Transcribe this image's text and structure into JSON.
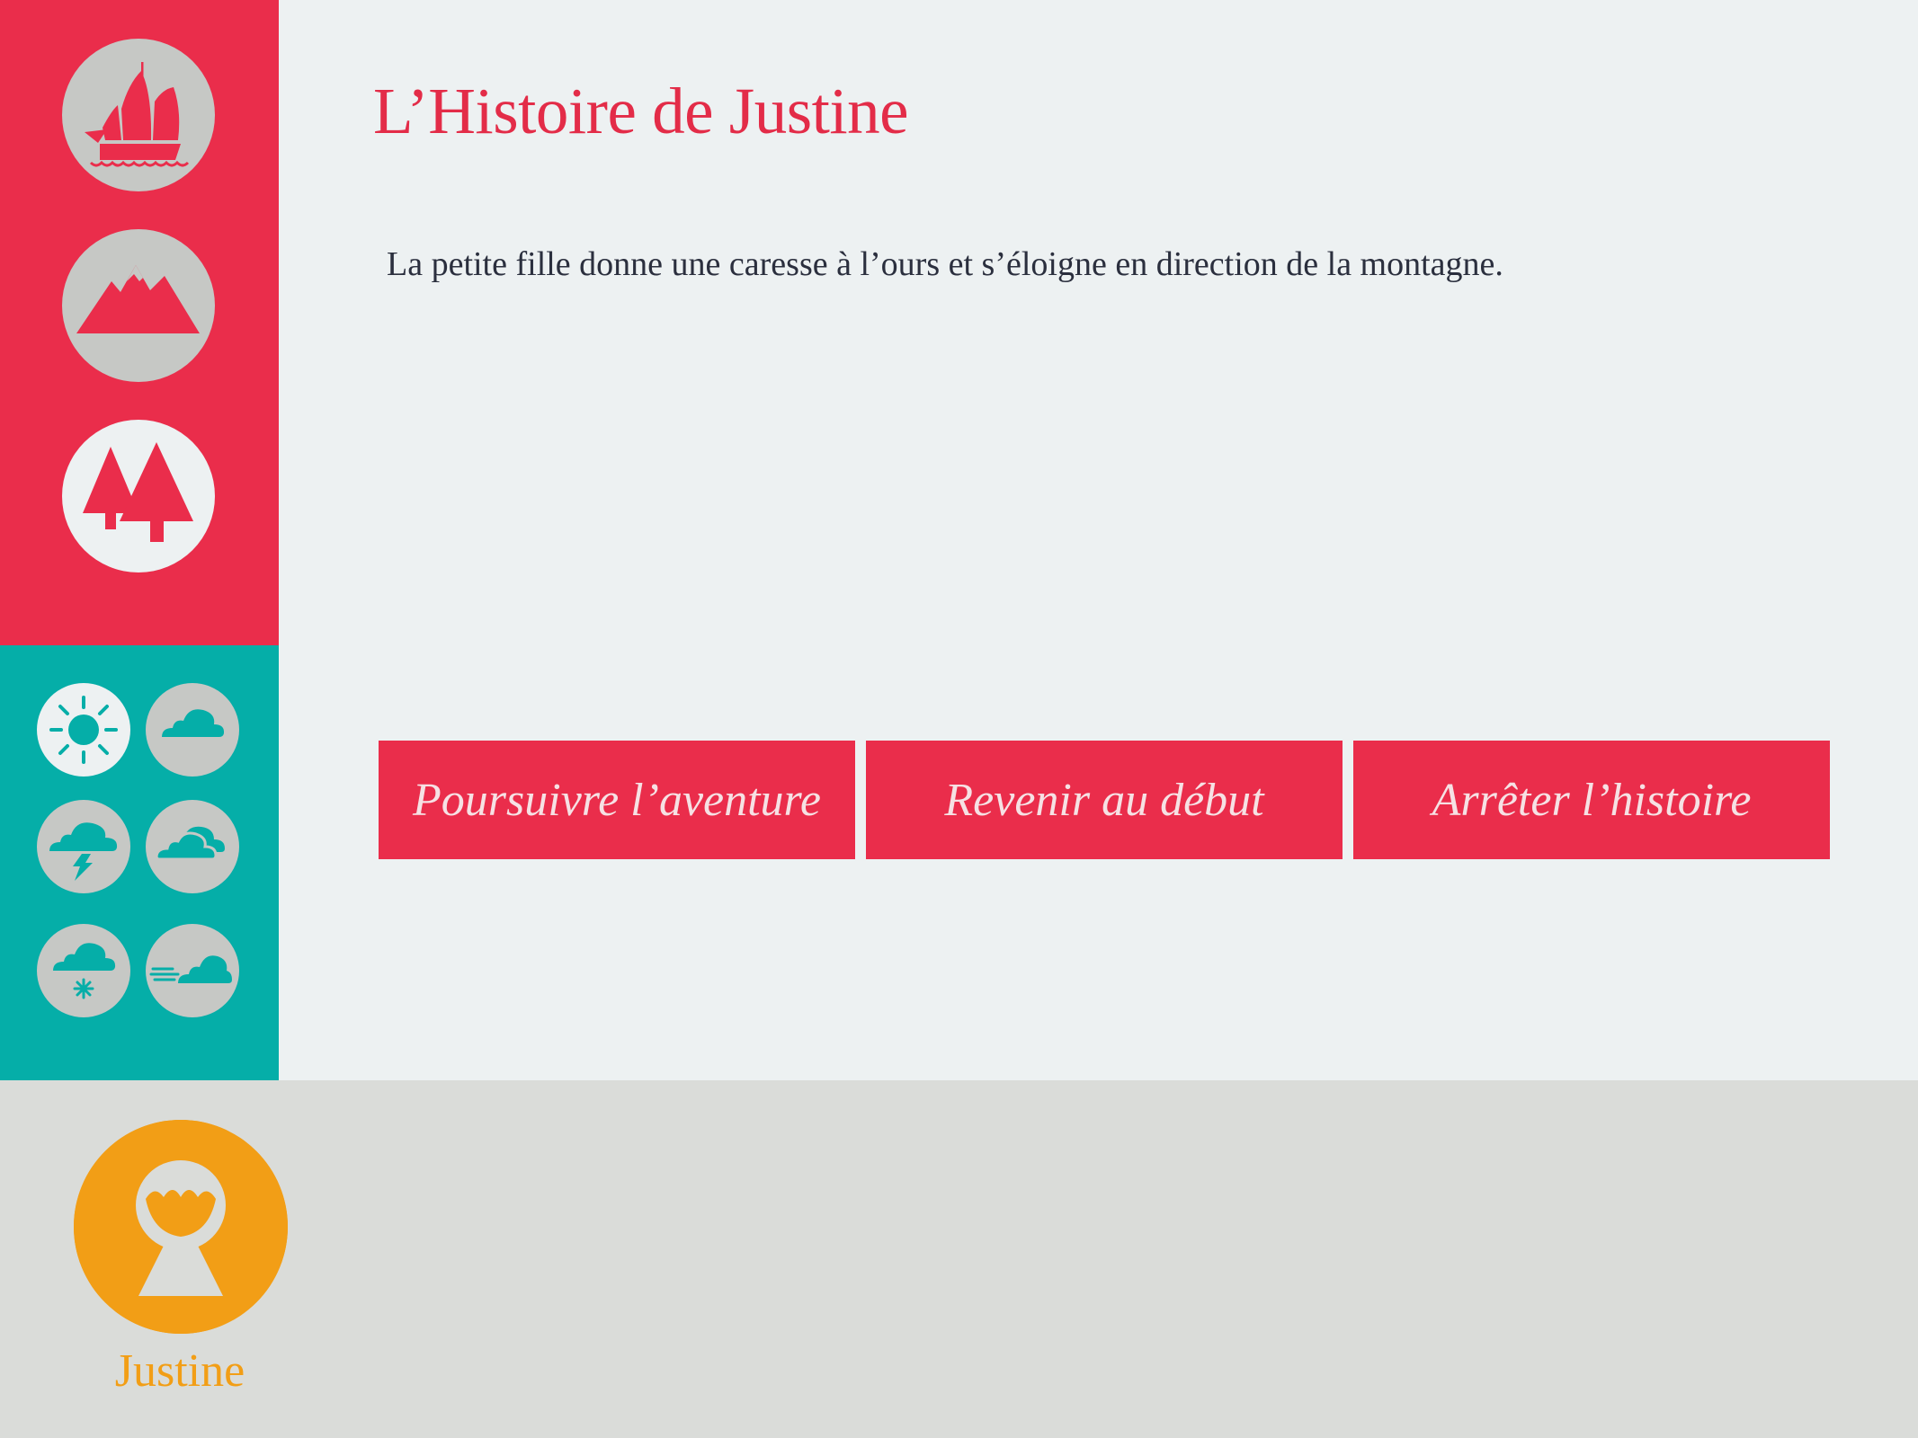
{
  "app": {
    "title": "L’Histoire de Justine"
  },
  "story": {
    "text": "La petite fille donne une caresse à l’ours et s’éloigne en direction de la montagne."
  },
  "choices": [
    {
      "label": "Poursuivre l’aventure"
    },
    {
      "label": "Revenir au début"
    },
    {
      "label": "Arrêter l’histoire"
    }
  ],
  "scenes": [
    {
      "icon": "junk-boat-icon",
      "selected": false
    },
    {
      "icon": "mountain-icon",
      "selected": false
    },
    {
      "icon": "forest-icon",
      "selected": true
    }
  ],
  "weather": [
    {
      "icon": "sun-icon",
      "selected": true
    },
    {
      "icon": "cloud-icon",
      "selected": false
    },
    {
      "icon": "storm-icon",
      "selected": false
    },
    {
      "icon": "clouds-icon",
      "selected": false
    },
    {
      "icon": "snow-icon",
      "selected": false
    },
    {
      "icon": "wind-icon",
      "selected": false
    }
  ],
  "character": {
    "name": "Justine",
    "icon": "girl-avatar-icon"
  },
  "colors": {
    "primary": "#ea2d4b",
    "teal": "#05aea8",
    "orange": "#f29e16",
    "background": "#edf1f2",
    "footer": "#dadcd9",
    "icon_grey": "#c6c8c5"
  }
}
